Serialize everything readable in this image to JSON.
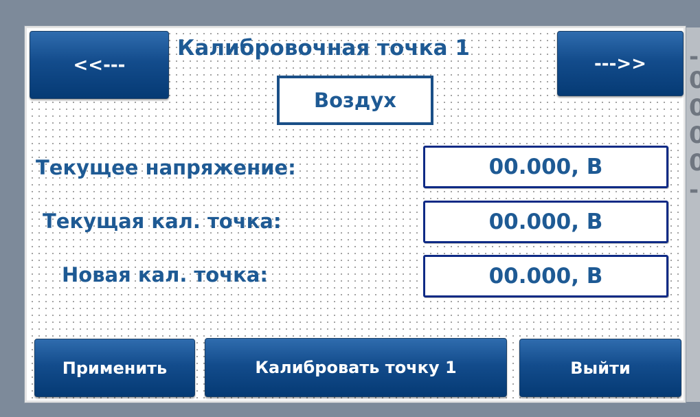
{
  "screen": {
    "title": "Калибровочная точка 1",
    "medium": "Воздух"
  },
  "nav": {
    "prev_label": "<<---",
    "next_label": "--->>"
  },
  "fields": [
    {
      "label": "Текущее напряжение:",
      "value": "00.000, В"
    },
    {
      "label": "Текущая кал. точка:",
      "value": "00.000, В"
    },
    {
      "label": "Новая кал. точка:",
      "value": "00.000, В"
    }
  ],
  "actions": {
    "apply_label": "Применить",
    "calibrate_label": "Калибровать точку 1",
    "exit_label": "Выйти"
  },
  "colors": {
    "button": "#134c8c",
    "text": "#1e5a94",
    "value_border": "#0e2a85",
    "background": "#7d8a9a"
  }
}
